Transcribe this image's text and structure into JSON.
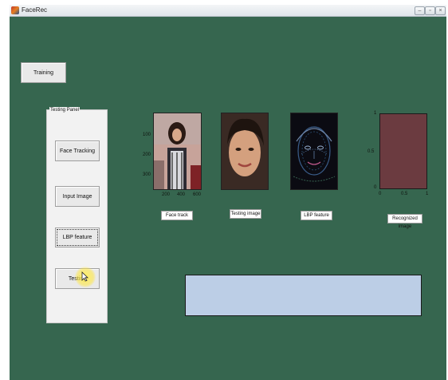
{
  "window": {
    "title": "FaceRec",
    "controls": {
      "minimize": "–",
      "maximize": "▫",
      "close": "×"
    }
  },
  "buttons": {
    "training": "Training",
    "face_tracking": "Face Tracking",
    "input_image": "Input Image",
    "lbp_feature": "LBP feature",
    "testing": "Testing"
  },
  "panel": {
    "title": "Testing Panel"
  },
  "axes1": {
    "yticks": [
      "100",
      "200",
      "300"
    ],
    "xticks": [
      "200",
      "400",
      "600"
    ],
    "label": "Face track"
  },
  "axes2": {
    "label": "Testing image"
  },
  "axes3": {
    "label": "LBP feature"
  },
  "axes4": {
    "yticks": [
      "1",
      "0.5",
      "0"
    ],
    "xticks": [
      "0",
      "0.5",
      "1"
    ],
    "label": "Recognized image"
  },
  "colors": {
    "background": "#36664f",
    "panel": "#f2f2f2",
    "result_box": "#bccee6",
    "recognized_fill": "#6b3b40"
  }
}
